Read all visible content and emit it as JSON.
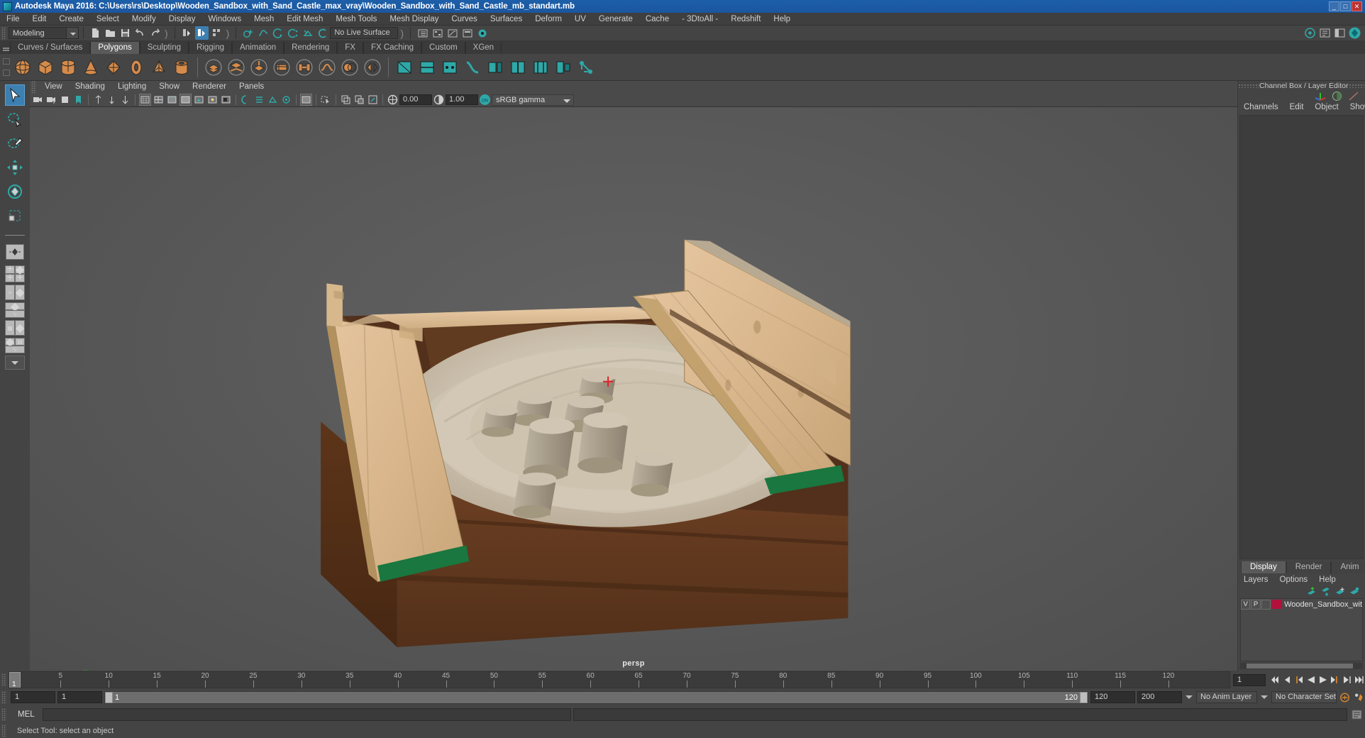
{
  "window": {
    "title": "Autodesk Maya 2016: C:\\Users\\rs\\Desktop\\Wooden_Sandbox_with_Sand_Castle_max_vray\\Wooden_Sandbox_with_Sand_Castle_mb_standart.mb",
    "minimize": "_",
    "maximize": "□",
    "close": "✕"
  },
  "menubar": {
    "items": [
      "File",
      "Edit",
      "Create",
      "Select",
      "Modify",
      "Display",
      "Windows",
      "Mesh",
      "Edit Mesh",
      "Mesh Tools",
      "Mesh Display",
      "Curves",
      "Surfaces",
      "Deform",
      "UV",
      "Generate",
      "Cache",
      "- 3DtoAll -",
      "Redshift",
      "Help"
    ]
  },
  "toolbar": {
    "mode": "Modeling",
    "live_surface": "No Live Surface"
  },
  "shelf": {
    "tabs": [
      {
        "label": "Curves / Surfaces",
        "selected": false
      },
      {
        "label": "Polygons",
        "selected": true
      },
      {
        "label": "Sculpting",
        "selected": false
      },
      {
        "label": "Rigging",
        "selected": false
      },
      {
        "label": "Animation",
        "selected": false
      },
      {
        "label": "Rendering",
        "selected": false
      },
      {
        "label": "FX",
        "selected": false
      },
      {
        "label": "FX Caching",
        "selected": false
      },
      {
        "label": "Custom",
        "selected": false
      },
      {
        "label": "XGen",
        "selected": false
      }
    ]
  },
  "viewport_menu": {
    "items": [
      "View",
      "Shading",
      "Lighting",
      "Show",
      "Renderer",
      "Panels"
    ]
  },
  "viewport_toolbar": {
    "exposure": "0.00",
    "gamma": "1.00",
    "color_profile": "sRGB gamma",
    "toggle_state": "ON"
  },
  "viewport": {
    "camera_label": "persp",
    "scene": "Wooden sandbox with sand castle - textured 3D model in shaded view"
  },
  "channel_box": {
    "panel_title": "Channel Box / Layer Editor",
    "menu": [
      "Channels",
      "Edit",
      "Object",
      "Show"
    ]
  },
  "layer_editor": {
    "tabs": [
      {
        "label": "Display",
        "selected": true
      },
      {
        "label": "Render",
        "selected": false
      },
      {
        "label": "Anim",
        "selected": false
      }
    ],
    "menu": [
      "Layers",
      "Options",
      "Help"
    ],
    "columns": {
      "visibility": "V",
      "playback": "P"
    },
    "layers": [
      {
        "visibility": "V",
        "playback": "P",
        "color": "#b4103c",
        "name": "Wooden_Sandbox_wit"
      }
    ]
  },
  "timeline": {
    "start": 1,
    "end": 120,
    "current_frame": "1",
    "ticks": [
      5,
      10,
      15,
      20,
      25,
      30,
      35,
      40,
      45,
      50,
      55,
      60,
      65,
      70,
      75,
      80,
      85,
      90,
      95,
      100,
      105,
      110,
      115,
      120
    ],
    "cursor_label": "1"
  },
  "range": {
    "anim_start": "1",
    "range_start": "1",
    "slider_min": "1",
    "slider_max": "120",
    "range_end": "120",
    "anim_end": "200",
    "anim_layer": "No Anim Layer",
    "character_set": "No Character Set"
  },
  "command_line": {
    "language_label": "MEL",
    "input_value": "",
    "output_value": ""
  },
  "status_line": {
    "message": "Select Tool: select an object"
  },
  "colors": {
    "title_bar": "#1d5fa8",
    "panel_bg": "#444444",
    "accent_blue": "#3c7fb1",
    "shelf_orange": "#d58b4a",
    "teal_icon": "#2fa8a8",
    "layer_swatch": "#b4103c"
  }
}
